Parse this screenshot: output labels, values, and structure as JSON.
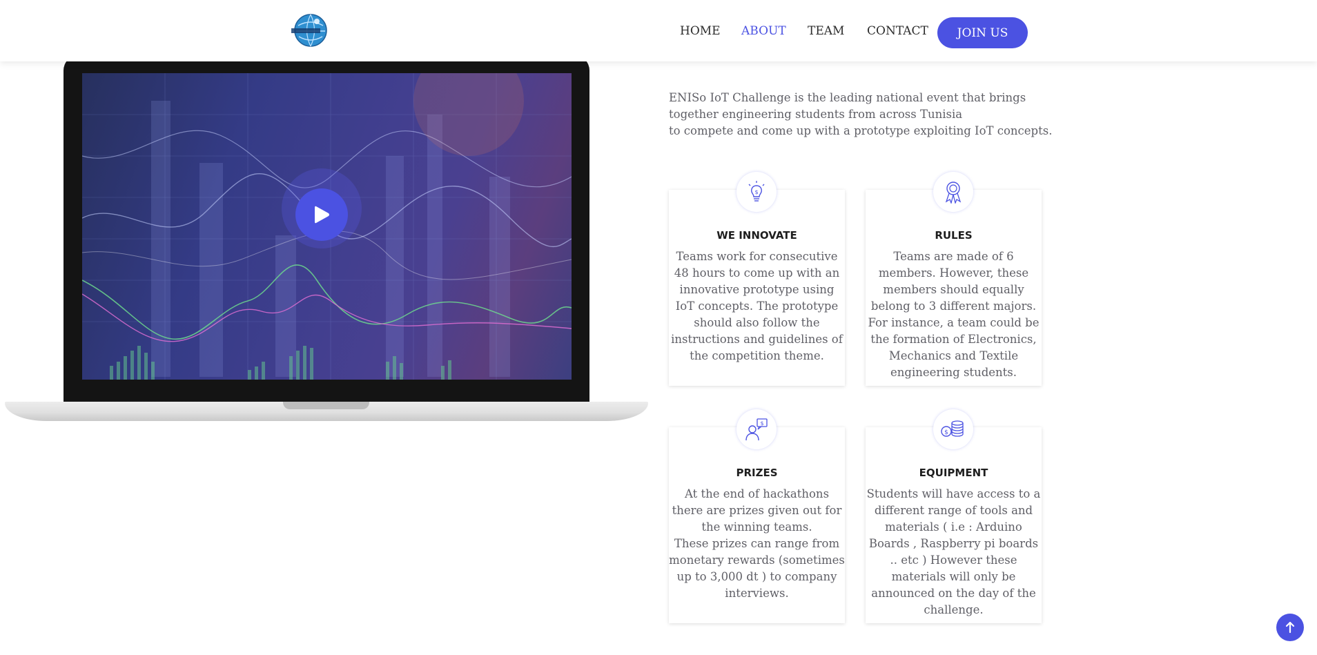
{
  "header": {
    "logo_icon": "globe-logo-icon",
    "nav": [
      "HOME",
      "ABOUT",
      "TEAM",
      "CONTACT"
    ],
    "active": "ABOUT",
    "cta": "JOIN US"
  },
  "video": {
    "play_icon": "play-icon"
  },
  "intro": "ENISo IoT Challenge is the leading national event that brings together engineering students from across Tunisia\nto compete and come up with a prototype exploiting IoT concepts.",
  "features": [
    {
      "icon": "lightbulb-dollar-icon",
      "title": "WE INNOVATE",
      "text": "Teams work for consecutive 48 hours to come up with an innovative prototype using IoT concepts. The prototype should also follow the instructions and guidelines of the competition theme."
    },
    {
      "icon": "award-ribbon-icon",
      "title": "RULES",
      "text": "Teams are made of 6 members. However, these members should equally belong to 3 different majors. For instance, a team could be the formation of Electronics, Mechanics and Textile engineering students."
    },
    {
      "icon": "person-money-icon",
      "title": "PRIZES",
      "text": "At the end of hackathons there are prizes given out for the winning teams.\nThese prizes can range from monetary rewards (sometimes up to 3,000 dt ) to company interviews."
    },
    {
      "icon": "coins-icon",
      "title": "EQUIPMENT",
      "text": "Students will have access to a different range of tools and materials ( i.e : Arduino Boards , Raspberry pi boards .. etc ) However these materials will only be announced on the day of the challenge."
    }
  ],
  "scroll_top_icon": "arrow-up-icon",
  "accent_color": "#4b52e2"
}
